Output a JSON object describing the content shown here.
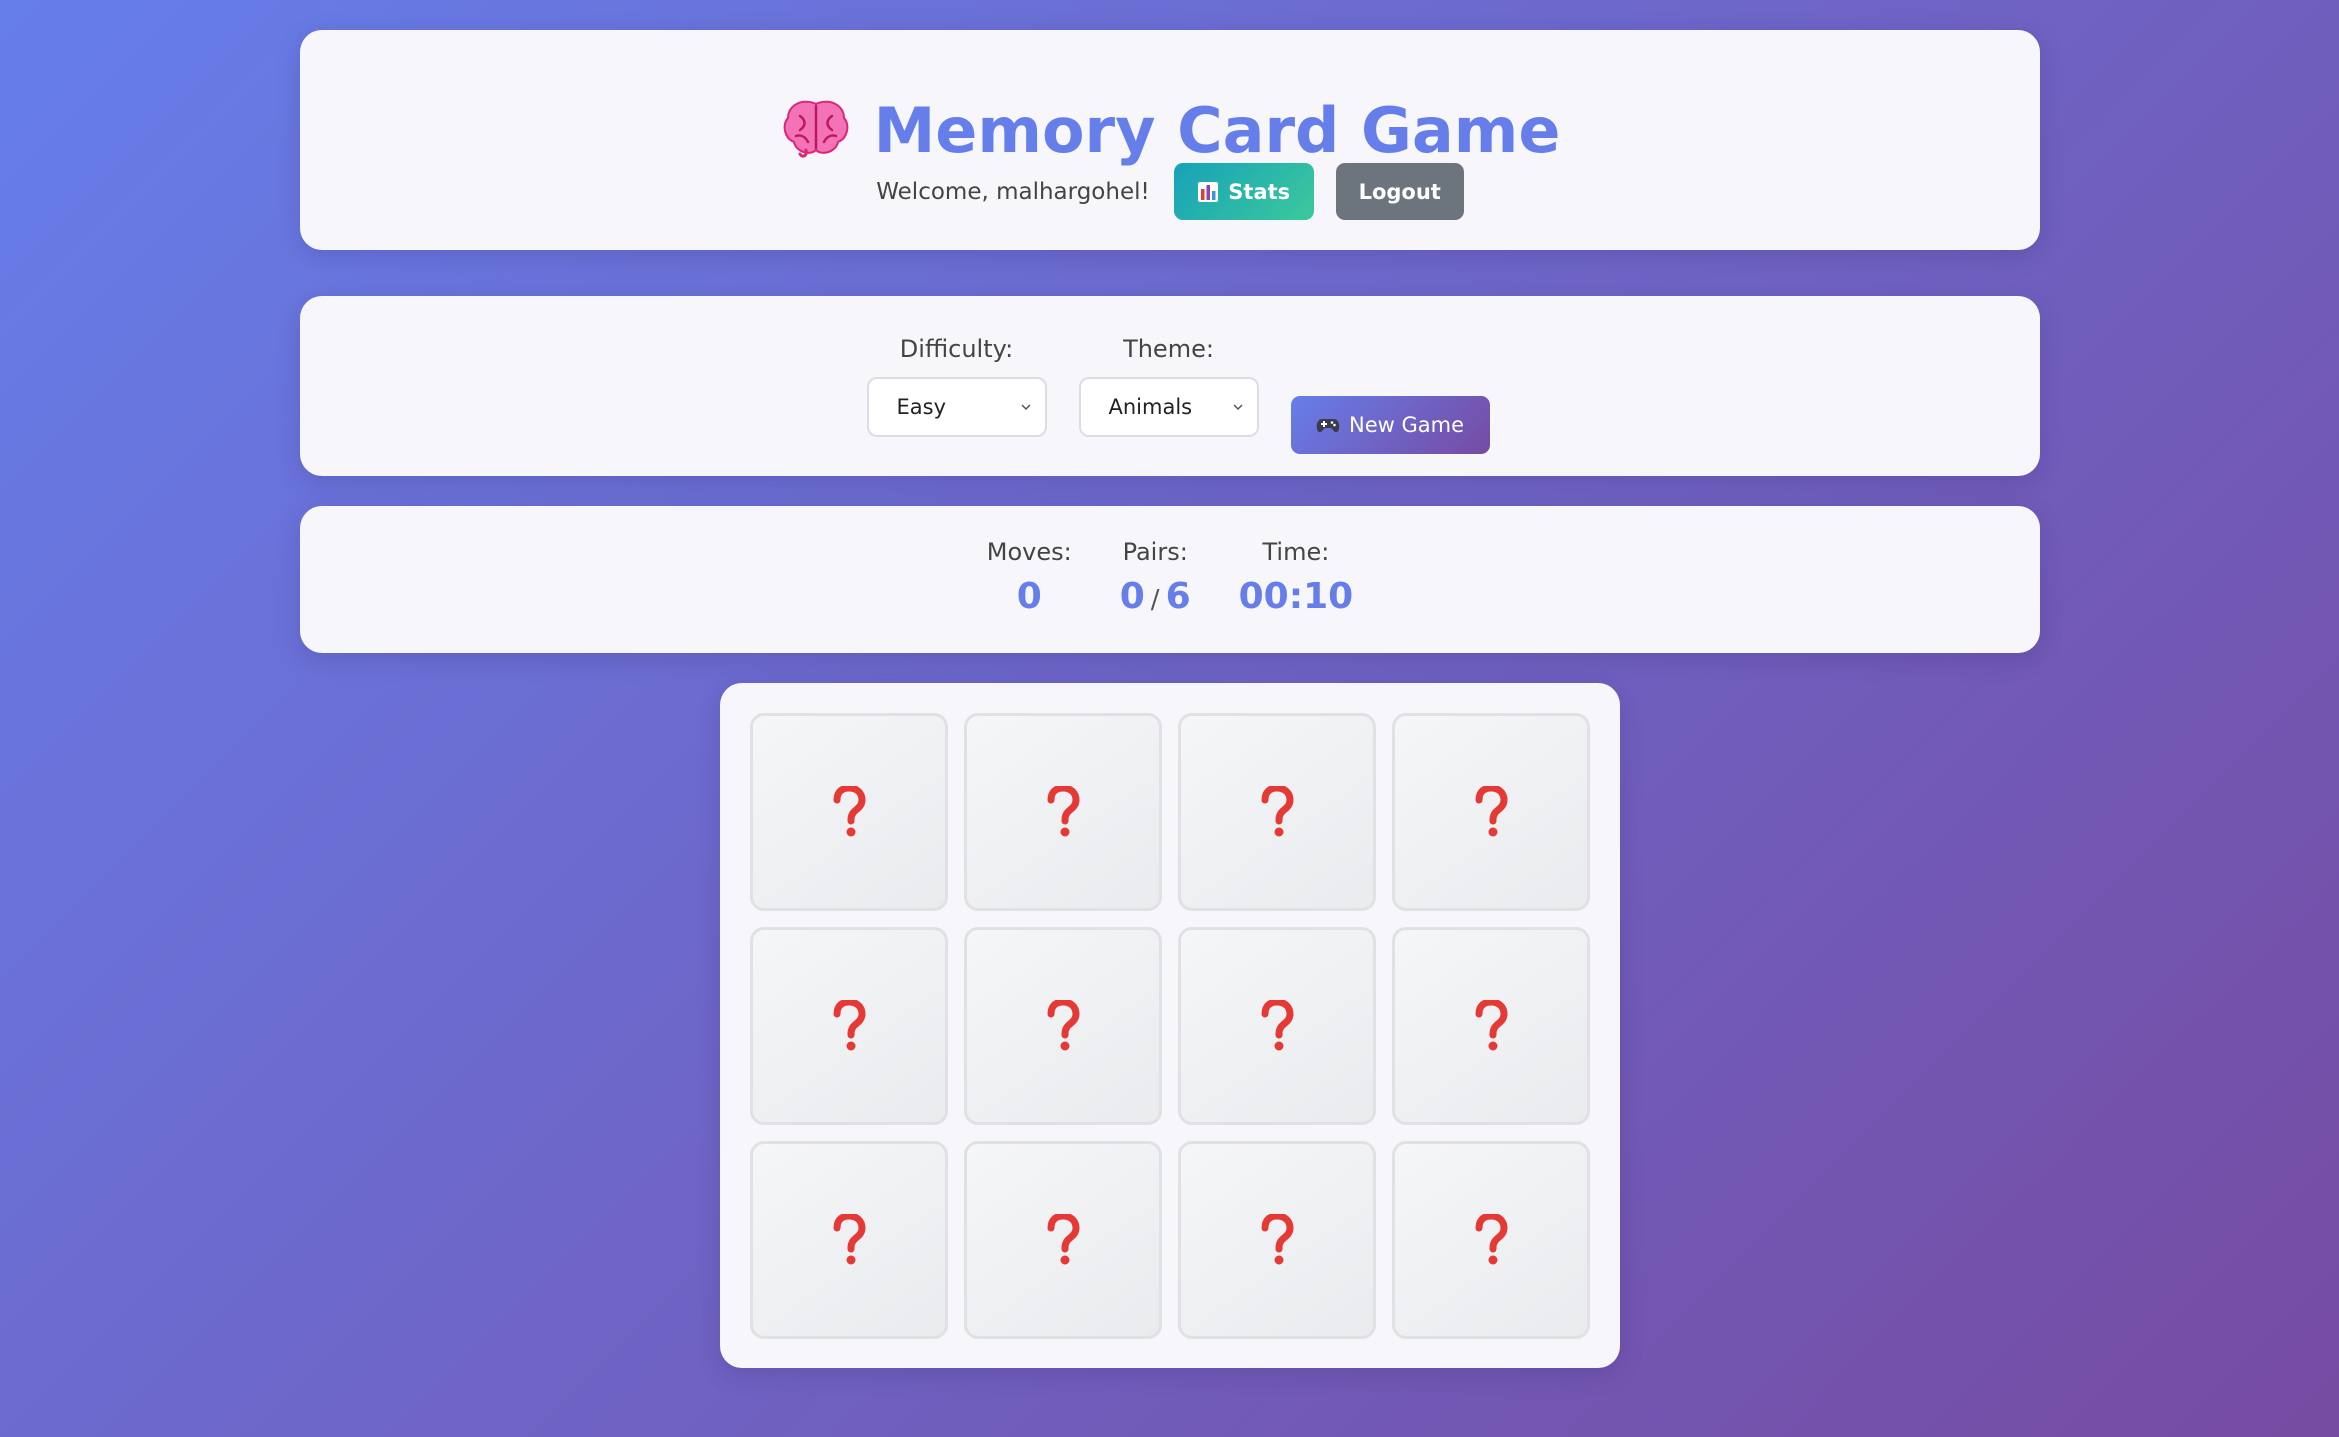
{
  "header": {
    "title": "Memory Card Game",
    "title_icon": "brain-icon",
    "welcome": "Welcome, malhargohel!",
    "stats_label": "Stats",
    "stats_icon": "bar-chart-icon",
    "logout_label": "Logout"
  },
  "controls": {
    "difficulty_label": "Difficulty:",
    "difficulty_value": "Easy",
    "theme_label": "Theme:",
    "theme_value": "Animals",
    "new_game_label": "New Game",
    "new_game_icon": "gamepad-icon"
  },
  "stats": {
    "moves_label": "Moves:",
    "moves": "0",
    "pairs_label": "Pairs:",
    "pairs_found": "0",
    "pairs_sep": "/",
    "pairs_total": "6",
    "time_label": "Time:",
    "time": "00:10"
  },
  "board": {
    "card_icon": "question-mark-icon",
    "cards": [
      "",
      "",
      "",
      "",
      "",
      "",
      "",
      "",
      "",
      "",
      "",
      ""
    ]
  },
  "colors": {
    "accent": "#667eea",
    "accent_end": "#764ba2",
    "question": "#e53935",
    "logout": "#6c757d",
    "stats_start": "#17a2b8",
    "stats_end": "#3cc99c"
  }
}
